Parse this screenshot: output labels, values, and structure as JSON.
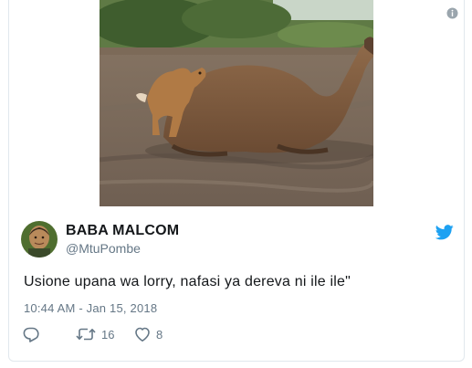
{
  "tweet": {
    "display_name": "BABA MALCOM",
    "handle": "@MtuPombe",
    "text": "Usione upana wa lorry, nafasi ya dereva ni ile ile\"",
    "timestamp": "10:44 AM - Jan 15, 2018",
    "retweet_count": "16",
    "like_count": "8"
  },
  "icons": {
    "info": "info-icon",
    "brand": "twitter-bird-icon",
    "reply": "reply-icon",
    "retweet": "retweet-icon",
    "like": "heart-icon"
  },
  "colors": {
    "brand_blue": "#1da1f2",
    "name_text": "#14171a",
    "secondary_text": "#657786",
    "border": "#e1e8ed"
  }
}
